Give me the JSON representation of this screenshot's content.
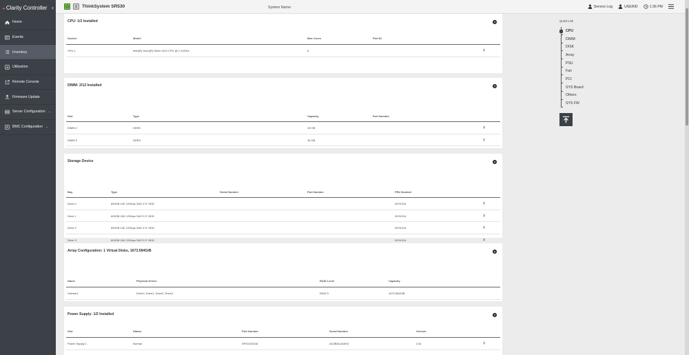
{
  "brand": {
    "name": "Clarity Controller",
    "mark": "◒"
  },
  "sidebar": {
    "items": [
      {
        "label": "Home",
        "icon": "home-icon",
        "active": false,
        "has_sub": false
      },
      {
        "label": "Events",
        "icon": "events-icon",
        "active": false,
        "has_sub": false
      },
      {
        "label": "Inventory",
        "icon": "list-icon",
        "active": true,
        "has_sub": false
      },
      {
        "label": "Utilization",
        "icon": "chart-icon",
        "active": false,
        "has_sub": false
      },
      {
        "label": "Remote Console",
        "icon": "external-link-icon",
        "active": false,
        "has_sub": false
      },
      {
        "label": "Firmware Update",
        "icon": "upload-icon",
        "active": false,
        "has_sub": false
      },
      {
        "label": "Server Configuration",
        "icon": "server-icon",
        "active": false,
        "has_sub": true
      },
      {
        "label": "BMC Configuration",
        "icon": "bmc-icon",
        "active": false,
        "has_sub": true
      }
    ]
  },
  "header": {
    "system": "ThinkSystem SR530",
    "system_name_label": "System Name:",
    "service_log": "Service Log",
    "user": "USERID",
    "time": "1:36 PM"
  },
  "cpu": {
    "title": "CPU:  1/2 Installed",
    "headers": [
      "Socket",
      "Model",
      "Max Cores",
      "Part ID"
    ],
    "rows": [
      [
        "CPU 1",
        "Intel(R) Xeon(R) Silver 4110 CPU @ 2.10GHz",
        "8",
        ""
      ]
    ]
  },
  "dimm": {
    "title": "DIMM:  2/12 Installed",
    "headers": [
      "Slot",
      "Type",
      "Capacity",
      "Part Number"
    ],
    "rows": [
      [
        "DIMM 2",
        "DDR4",
        "16 GB",
        ""
      ],
      [
        "DIMM 3",
        "DDR4",
        "16 GB",
        ""
      ]
    ]
  },
  "storage": {
    "title": "Storage Device",
    "headers": [
      "Bay",
      "Type",
      "Serial Number",
      "Part Number",
      "FRU Number"
    ],
    "rows": [
      [
        "Drive 0",
        "600GB 10K 12Gbps SAS 2.5\" HDD",
        "",
        "",
        "00YK014"
      ],
      [
        "Drive 1",
        "600GB 10K 12Gbps SAS 2.5\" HDD",
        "",
        "",
        "00YK014"
      ],
      [
        "Drive 2",
        "600GB 10K 12Gbps SAS 2.5\" HDD",
        "",
        "",
        "00YK014"
      ],
      [
        "Drive 3",
        "600GB 10K 12Gbps SAS 2.5\" HDD",
        "",
        "",
        "00YK014"
      ]
    ]
  },
  "array": {
    "title": "Array Configuration:  1 Virtual Disks, 1673.584GiB",
    "headers": [
      "Name",
      "Physical Drives",
      "RAID Level",
      "Capacity"
    ],
    "rows": [
      [
        "Volume1",
        "Drive0, Drive1, Drive2, Drive3",
        "RAID 5",
        "1673.584GiB"
      ]
    ]
  },
  "psu": {
    "title": "Power Supply:  1/2 Installed",
    "headers": [
      "Slot",
      "Status",
      "Part Number",
      "Serial Number",
      "Version"
    ],
    "rows": [
      [
        "Power Supply 1",
        "Normal",
        "SP57A03118",
        "A1DB8CAA3H2",
        "2.61"
      ]
    ]
  },
  "quick_link": {
    "title": "Quick Link",
    "items": [
      "CPU",
      "DIMM",
      "DISK",
      "Array",
      "PSU",
      "Fan",
      "PCI",
      "SYS Board",
      "Others",
      "SYS FW"
    ],
    "active": "CPU"
  },
  "colors": {
    "sidebar": "#3c4148",
    "power_ok": "#8bc34a"
  }
}
